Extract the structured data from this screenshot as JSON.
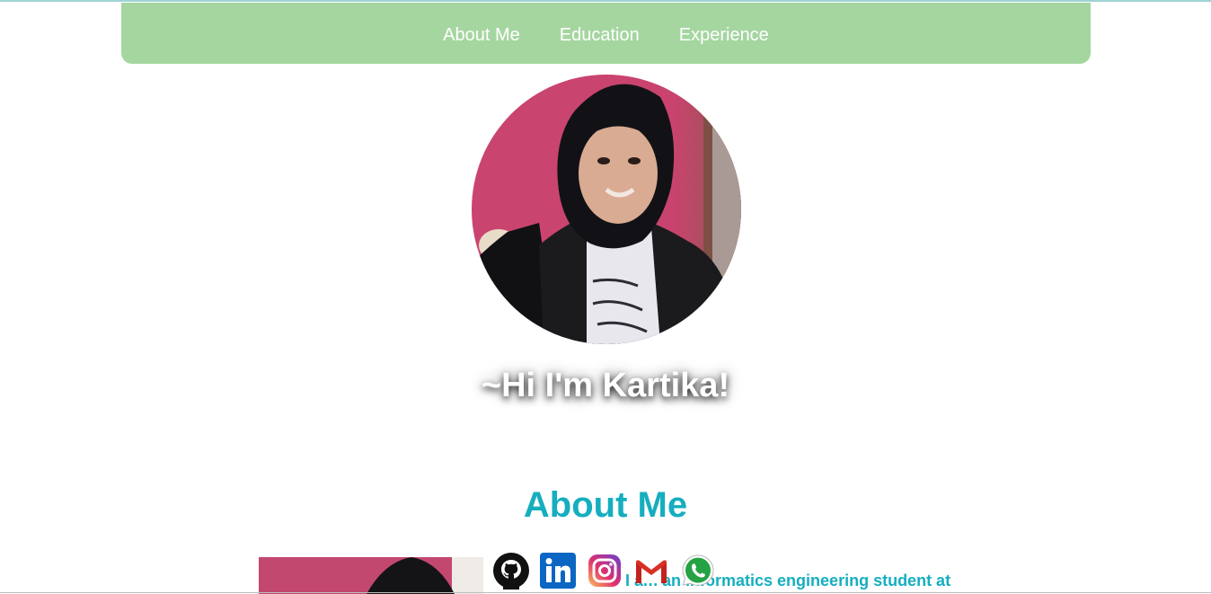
{
  "nav": {
    "items": [
      {
        "label": "About Me"
      },
      {
        "label": "Education"
      },
      {
        "label": "Experience"
      }
    ]
  },
  "hero": {
    "greeting": "~Hi I'm Kartika!"
  },
  "about": {
    "title": "About Me",
    "text_visible": "I am an informatics engineering student at"
  },
  "socials": [
    {
      "icon": "github-icon"
    },
    {
      "icon": "linkedin-icon"
    },
    {
      "icon": "instagram-icon"
    },
    {
      "icon": "gmail-icon"
    },
    {
      "icon": "whatsapp-icon"
    }
  ],
  "colors": {
    "nav_bg": "#a5d6a0",
    "accent": "#15aebf",
    "nav_text": "#ffffff"
  }
}
